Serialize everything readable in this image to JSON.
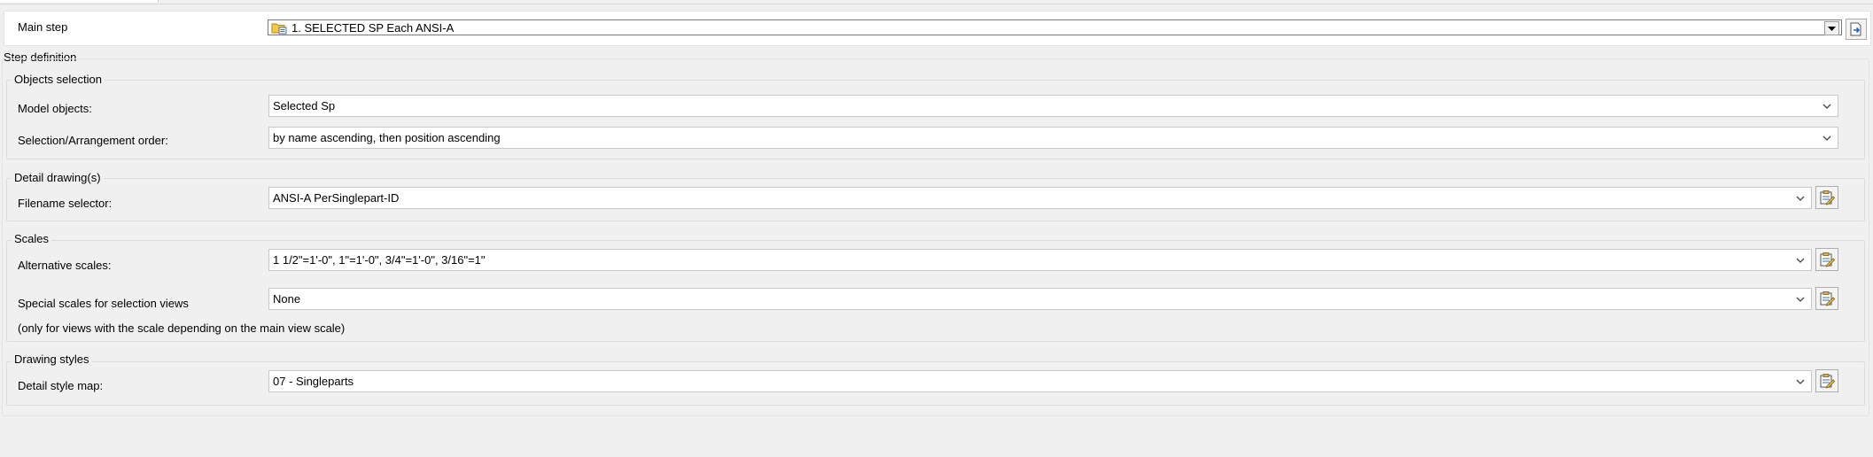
{
  "main_step": {
    "label": "Main step",
    "value": "1. SELECTED SP Each ANSI-A"
  },
  "step_definition": {
    "title": "Step definition"
  },
  "objects_selection": {
    "title": "Objects selection",
    "model_objects_label": "Model objects:",
    "model_objects_value": "Selected Sp",
    "order_label": "Selection/Arrangement order:",
    "order_value": "by name ascending, then position ascending"
  },
  "detail_drawings": {
    "title": "Detail drawing(s)",
    "filename_label": "Filename selector:",
    "filename_value": "ANSI-A PerSinglepart-ID"
  },
  "scales": {
    "title": "Scales",
    "alternative_label": "Alternative scales:",
    "alternative_value": "1 1/2\"=1'-0\", 1\"=1'-0\", 3/4\"=1'-0\", 3/16\"=1\"",
    "special_label": "Special scales for selection views",
    "special_value": "None",
    "special_note": "(only for views with the scale depending on the main view scale)"
  },
  "drawing_styles": {
    "title": "Drawing styles",
    "style_map_label": "Detail style map:",
    "style_map_value": "07 - Singleparts"
  },
  "icons": {
    "dropdown": "chevron-down-icon",
    "folder": "folder-icon",
    "edit": "edit-list-icon",
    "open": "open-document-icon"
  }
}
